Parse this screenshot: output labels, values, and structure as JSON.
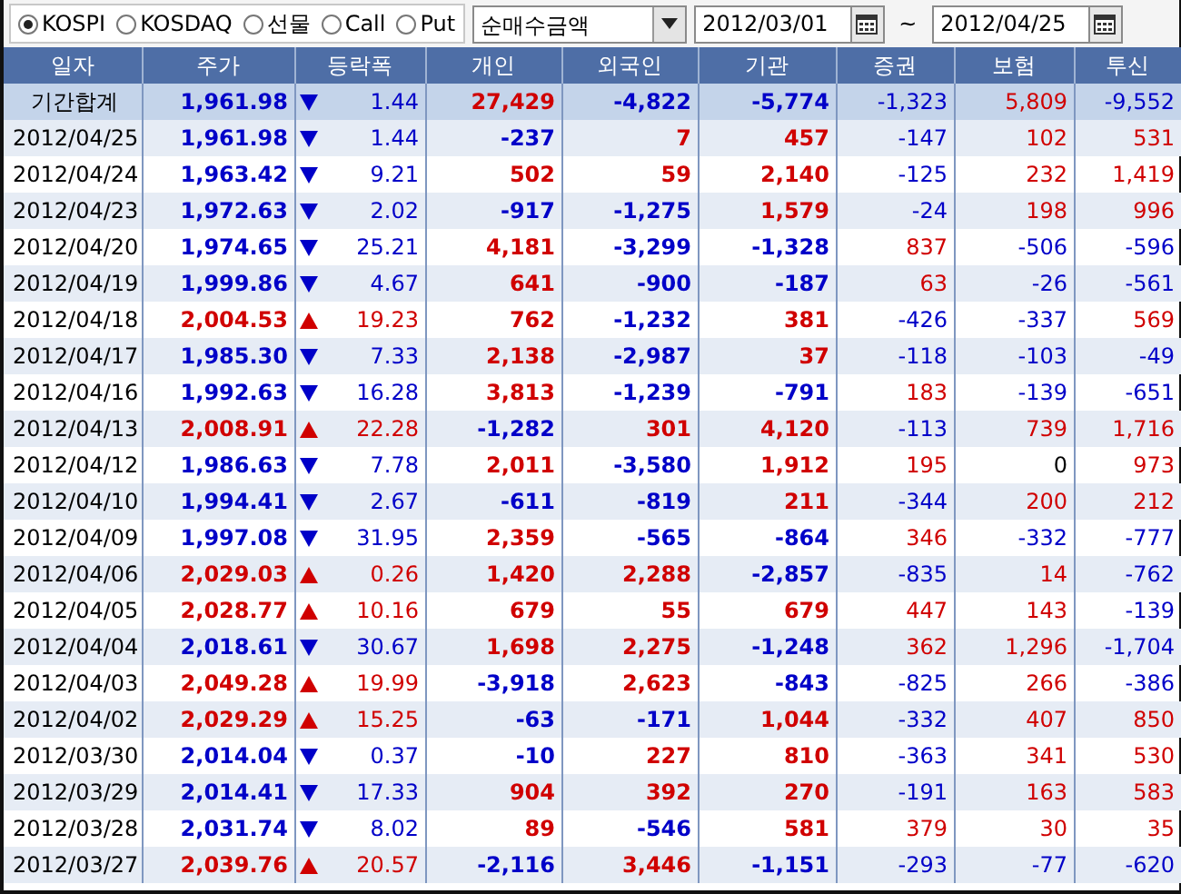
{
  "market_options": [
    {
      "label": "KOSPI",
      "selected": true
    },
    {
      "label": "KOSDAQ",
      "selected": false
    },
    {
      "label": "선물",
      "selected": false
    },
    {
      "label": "Call",
      "selected": false
    },
    {
      "label": "Put",
      "selected": false
    }
  ],
  "measure_select": {
    "value": "순매수금액"
  },
  "date_from": {
    "value": "2012/03/01"
  },
  "range_separator": "~",
  "date_to": {
    "value": "2012/04/25"
  },
  "table": {
    "columns": [
      "일자",
      "주가",
      "등락폭",
      "개인",
      "외국인",
      "기관",
      "증권",
      "보험",
      "투신"
    ],
    "rows": [
      {
        "kind": "summary",
        "label": "기간합계",
        "rising": false,
        "price": "1,961.98",
        "change": "1.44",
        "values": [
          {
            "text": "27,429",
            "color": "#d00000"
          },
          {
            "text": "-4,822",
            "color": "#0000c8"
          },
          {
            "text": "-5,774",
            "color": "#0000c8"
          },
          {
            "text": "-1,323",
            "color": "#0000c8"
          },
          {
            "text": "5,809",
            "color": "#d00000"
          },
          {
            "text": "-9,552",
            "color": "#0000c8"
          }
        ]
      },
      {
        "kind": "day",
        "label": "2012/04/25",
        "rising": false,
        "price": "1,961.98",
        "change": "1.44",
        "values": [
          {
            "text": "-237",
            "color": "#0000c8"
          },
          {
            "text": "7",
            "color": "#d00000"
          },
          {
            "text": "457",
            "color": "#d00000"
          },
          {
            "text": "-147",
            "color": "#0000c8"
          },
          {
            "text": "102",
            "color": "#d00000"
          },
          {
            "text": "531",
            "color": "#d00000"
          }
        ]
      },
      {
        "kind": "day",
        "label": "2012/04/24",
        "rising": false,
        "price": "1,963.42",
        "change": "9.21",
        "values": [
          {
            "text": "502",
            "color": "#d00000"
          },
          {
            "text": "59",
            "color": "#d00000"
          },
          {
            "text": "2,140",
            "color": "#d00000"
          },
          {
            "text": "-125",
            "color": "#0000c8"
          },
          {
            "text": "232",
            "color": "#d00000"
          },
          {
            "text": "1,419",
            "color": "#d00000"
          }
        ]
      },
      {
        "kind": "day",
        "label": "2012/04/23",
        "rising": false,
        "price": "1,972.63",
        "change": "2.02",
        "values": [
          {
            "text": "-917",
            "color": "#0000c8"
          },
          {
            "text": "-1,275",
            "color": "#0000c8"
          },
          {
            "text": "1,579",
            "color": "#d00000"
          },
          {
            "text": "-24",
            "color": "#0000c8"
          },
          {
            "text": "198",
            "color": "#d00000"
          },
          {
            "text": "996",
            "color": "#d00000"
          }
        ]
      },
      {
        "kind": "day",
        "label": "2012/04/20",
        "rising": false,
        "price": "1,974.65",
        "change": "25.21",
        "values": [
          {
            "text": "4,181",
            "color": "#d00000"
          },
          {
            "text": "-3,299",
            "color": "#0000c8"
          },
          {
            "text": "-1,328",
            "color": "#0000c8"
          },
          {
            "text": "837",
            "color": "#d00000"
          },
          {
            "text": "-506",
            "color": "#0000c8"
          },
          {
            "text": "-596",
            "color": "#0000c8"
          }
        ]
      },
      {
        "kind": "day",
        "label": "2012/04/19",
        "rising": false,
        "price": "1,999.86",
        "change": "4.67",
        "values": [
          {
            "text": "641",
            "color": "#d00000"
          },
          {
            "text": "-900",
            "color": "#0000c8"
          },
          {
            "text": "-187",
            "color": "#0000c8"
          },
          {
            "text": "63",
            "color": "#d00000"
          },
          {
            "text": "-26",
            "color": "#0000c8"
          },
          {
            "text": "-561",
            "color": "#0000c8"
          }
        ]
      },
      {
        "kind": "day",
        "label": "2012/04/18",
        "rising": true,
        "price": "2,004.53",
        "change": "19.23",
        "values": [
          {
            "text": "762",
            "color": "#d00000"
          },
          {
            "text": "-1,232",
            "color": "#0000c8"
          },
          {
            "text": "381",
            "color": "#d00000"
          },
          {
            "text": "-426",
            "color": "#0000c8"
          },
          {
            "text": "-337",
            "color": "#0000c8"
          },
          {
            "text": "569",
            "color": "#d00000"
          }
        ]
      },
      {
        "kind": "day",
        "label": "2012/04/17",
        "rising": false,
        "price": "1,985.30",
        "change": "7.33",
        "values": [
          {
            "text": "2,138",
            "color": "#d00000"
          },
          {
            "text": "-2,987",
            "color": "#0000c8"
          },
          {
            "text": "37",
            "color": "#d00000"
          },
          {
            "text": "-118",
            "color": "#0000c8"
          },
          {
            "text": "-103",
            "color": "#0000c8"
          },
          {
            "text": "-49",
            "color": "#0000c8"
          }
        ]
      },
      {
        "kind": "day",
        "label": "2012/04/16",
        "rising": false,
        "price": "1,992.63",
        "change": "16.28",
        "values": [
          {
            "text": "3,813",
            "color": "#d00000"
          },
          {
            "text": "-1,239",
            "color": "#0000c8"
          },
          {
            "text": "-791",
            "color": "#0000c8"
          },
          {
            "text": "183",
            "color": "#d00000"
          },
          {
            "text": "-139",
            "color": "#0000c8"
          },
          {
            "text": "-651",
            "color": "#0000c8"
          }
        ]
      },
      {
        "kind": "day",
        "label": "2012/04/13",
        "rising": true,
        "price": "2,008.91",
        "change": "22.28",
        "values": [
          {
            "text": "-1,282",
            "color": "#0000c8"
          },
          {
            "text": "301",
            "color": "#d00000"
          },
          {
            "text": "4,120",
            "color": "#d00000"
          },
          {
            "text": "-113",
            "color": "#0000c8"
          },
          {
            "text": "739",
            "color": "#d00000"
          },
          {
            "text": "1,716",
            "color": "#d00000"
          }
        ]
      },
      {
        "kind": "day",
        "label": "2012/04/12",
        "rising": false,
        "price": "1,986.63",
        "change": "7.78",
        "values": [
          {
            "text": "2,011",
            "color": "#d00000"
          },
          {
            "text": "-3,580",
            "color": "#0000c8"
          },
          {
            "text": "1,912",
            "color": "#d00000"
          },
          {
            "text": "195",
            "color": "#d00000"
          },
          {
            "text": "0",
            "color": "#000000"
          },
          {
            "text": "973",
            "color": "#d00000"
          }
        ]
      },
      {
        "kind": "day",
        "label": "2012/04/10",
        "rising": false,
        "price": "1,994.41",
        "change": "2.67",
        "values": [
          {
            "text": "-611",
            "color": "#0000c8"
          },
          {
            "text": "-819",
            "color": "#0000c8"
          },
          {
            "text": "211",
            "color": "#d00000"
          },
          {
            "text": "-344",
            "color": "#0000c8"
          },
          {
            "text": "200",
            "color": "#d00000"
          },
          {
            "text": "212",
            "color": "#d00000"
          }
        ]
      },
      {
        "kind": "day",
        "label": "2012/04/09",
        "rising": false,
        "price": "1,997.08",
        "change": "31.95",
        "values": [
          {
            "text": "2,359",
            "color": "#d00000"
          },
          {
            "text": "-565",
            "color": "#0000c8"
          },
          {
            "text": "-864",
            "color": "#0000c8"
          },
          {
            "text": "346",
            "color": "#d00000"
          },
          {
            "text": "-332",
            "color": "#0000c8"
          },
          {
            "text": "-777",
            "color": "#0000c8"
          }
        ]
      },
      {
        "kind": "day",
        "label": "2012/04/06",
        "rising": true,
        "price": "2,029.03",
        "change": "0.26",
        "values": [
          {
            "text": "1,420",
            "color": "#d00000"
          },
          {
            "text": "2,288",
            "color": "#d00000"
          },
          {
            "text": "-2,857",
            "color": "#0000c8"
          },
          {
            "text": "-835",
            "color": "#0000c8"
          },
          {
            "text": "14",
            "color": "#d00000"
          },
          {
            "text": "-762",
            "color": "#0000c8"
          }
        ]
      },
      {
        "kind": "day",
        "label": "2012/04/05",
        "rising": true,
        "price": "2,028.77",
        "change": "10.16",
        "values": [
          {
            "text": "679",
            "color": "#d00000"
          },
          {
            "text": "55",
            "color": "#d00000"
          },
          {
            "text": "679",
            "color": "#d00000"
          },
          {
            "text": "447",
            "color": "#d00000"
          },
          {
            "text": "143",
            "color": "#d00000"
          },
          {
            "text": "-139",
            "color": "#0000c8"
          }
        ]
      },
      {
        "kind": "day",
        "label": "2012/04/04",
        "rising": false,
        "price": "2,018.61",
        "change": "30.67",
        "values": [
          {
            "text": "1,698",
            "color": "#d00000"
          },
          {
            "text": "2,275",
            "color": "#d00000"
          },
          {
            "text": "-1,248",
            "color": "#0000c8"
          },
          {
            "text": "362",
            "color": "#d00000"
          },
          {
            "text": "1,296",
            "color": "#d00000"
          },
          {
            "text": "-1,704",
            "color": "#0000c8"
          }
        ]
      },
      {
        "kind": "day",
        "label": "2012/04/03",
        "rising": true,
        "price": "2,049.28",
        "change": "19.99",
        "values": [
          {
            "text": "-3,918",
            "color": "#0000c8"
          },
          {
            "text": "2,623",
            "color": "#d00000"
          },
          {
            "text": "-843",
            "color": "#0000c8"
          },
          {
            "text": "-825",
            "color": "#0000c8"
          },
          {
            "text": "266",
            "color": "#d00000"
          },
          {
            "text": "-386",
            "color": "#0000c8"
          }
        ]
      },
      {
        "kind": "day",
        "label": "2012/04/02",
        "rising": true,
        "price": "2,029.29",
        "change": "15.25",
        "values": [
          {
            "text": "-63",
            "color": "#0000c8"
          },
          {
            "text": "-171",
            "color": "#0000c8"
          },
          {
            "text": "1,044",
            "color": "#d00000"
          },
          {
            "text": "-332",
            "color": "#0000c8"
          },
          {
            "text": "407",
            "color": "#d00000"
          },
          {
            "text": "850",
            "color": "#d00000"
          }
        ]
      },
      {
        "kind": "day",
        "label": "2012/03/30",
        "rising": false,
        "price": "2,014.04",
        "change": "0.37",
        "values": [
          {
            "text": "-10",
            "color": "#0000c8"
          },
          {
            "text": "227",
            "color": "#d00000"
          },
          {
            "text": "810",
            "color": "#d00000"
          },
          {
            "text": "-363",
            "color": "#0000c8"
          },
          {
            "text": "341",
            "color": "#d00000"
          },
          {
            "text": "530",
            "color": "#d00000"
          }
        ]
      },
      {
        "kind": "day",
        "label": "2012/03/29",
        "rising": false,
        "price": "2,014.41",
        "change": "17.33",
        "values": [
          {
            "text": "904",
            "color": "#d00000"
          },
          {
            "text": "392",
            "color": "#d00000"
          },
          {
            "text": "270",
            "color": "#d00000"
          },
          {
            "text": "-191",
            "color": "#0000c8"
          },
          {
            "text": "163",
            "color": "#d00000"
          },
          {
            "text": "583",
            "color": "#d00000"
          }
        ]
      },
      {
        "kind": "day",
        "label": "2012/03/28",
        "rising": false,
        "price": "2,031.74",
        "change": "8.02",
        "values": [
          {
            "text": "89",
            "color": "#d00000"
          },
          {
            "text": "-546",
            "color": "#0000c8"
          },
          {
            "text": "581",
            "color": "#d00000"
          },
          {
            "text": "379",
            "color": "#d00000"
          },
          {
            "text": "30",
            "color": "#d00000"
          },
          {
            "text": "35",
            "color": "#d00000"
          }
        ]
      },
      {
        "kind": "day",
        "label": "2012/03/27",
        "rising": true,
        "price": "2,039.76",
        "change": "20.57",
        "values": [
          {
            "text": "-2,116",
            "color": "#0000c8"
          },
          {
            "text": "3,446",
            "color": "#d00000"
          },
          {
            "text": "-1,151",
            "color": "#0000c8"
          },
          {
            "text": "-293",
            "color": "#0000c8"
          },
          {
            "text": "-77",
            "color": "#0000c8"
          },
          {
            "text": "-620",
            "color": "#0000c8"
          }
        ]
      }
    ]
  }
}
